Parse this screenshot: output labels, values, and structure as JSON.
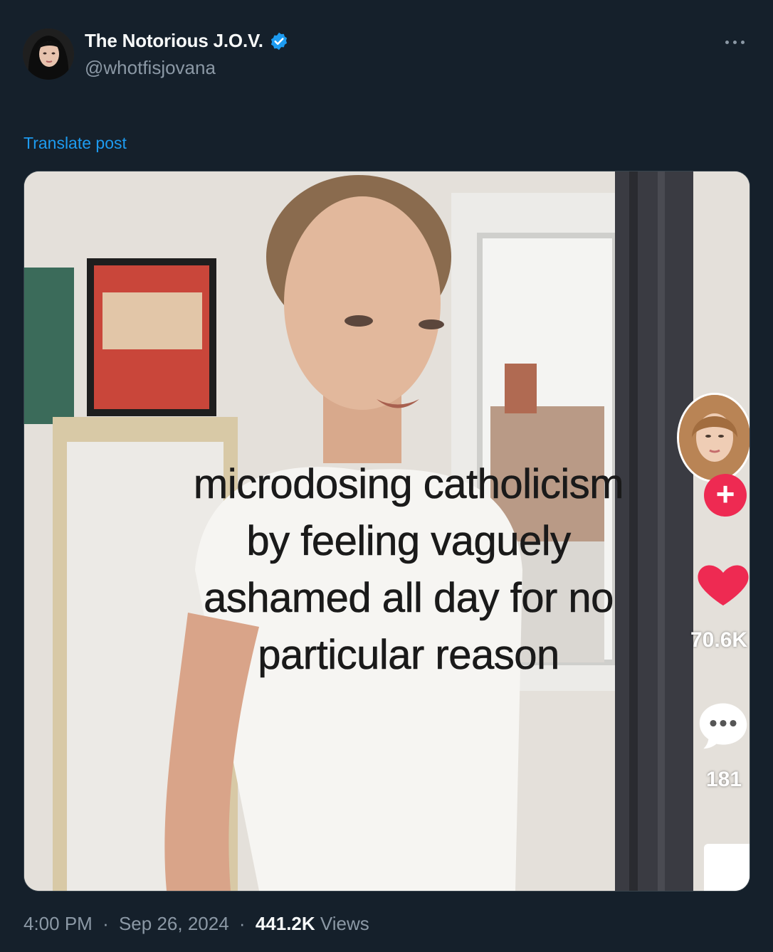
{
  "author": {
    "display_name": "The Notorious J.O.V.",
    "handle": "@whotfisjovana",
    "verified": true,
    "verified_icon": "verified-badge-icon",
    "verified_color": "#1d9bf0"
  },
  "post": {
    "translate_label": "Translate post",
    "timestamp_time": "4:00 PM",
    "timestamp_date": "Sep 26, 2024",
    "views_count": "441.2K",
    "views_label": "Views",
    "separator": "·"
  },
  "media": {
    "caption_lines": [
      "microdosing catholicism",
      "by feeling vaguely",
      "ashamed all day for no",
      "particular reason"
    ],
    "overlay": {
      "likes": "70.6K",
      "comments": "181",
      "follow_symbol": "+",
      "like_icon": "heart-icon",
      "comment_icon": "comment-bubble-icon",
      "share_icon": "share-icon",
      "like_color": "#ee2a52"
    }
  },
  "colors": {
    "background": "#15202b",
    "primary_text": "#f7f9f9",
    "secondary_text": "#8b98a5",
    "link": "#1d9bf0"
  }
}
